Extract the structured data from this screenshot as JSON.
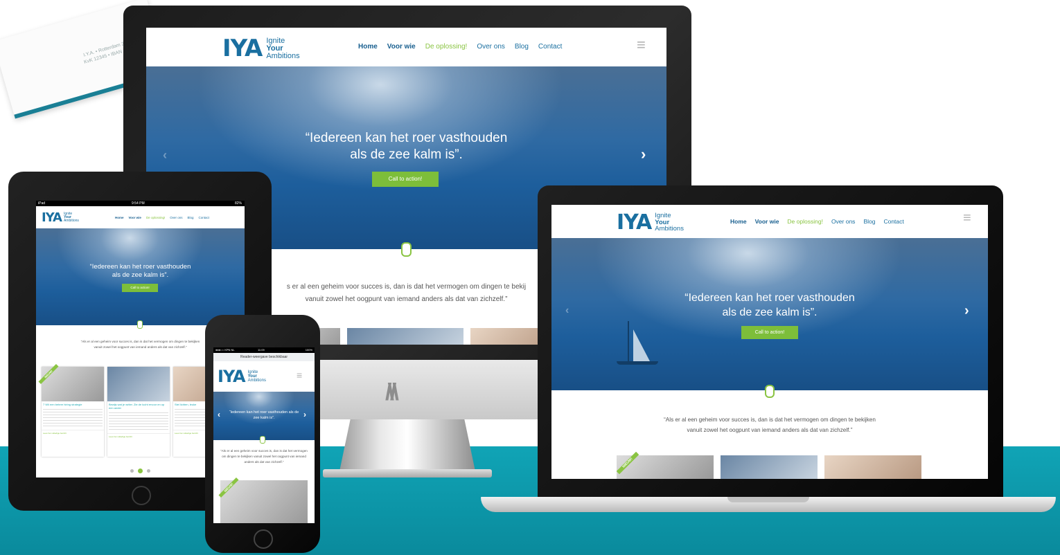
{
  "brand": {
    "mark": "IYA",
    "line1": "Ignite",
    "line2": "Your",
    "line3": "Ambitions"
  },
  "nav": {
    "items": [
      "Home",
      "Voor wie",
      "De oplossing!",
      "Over ons",
      "Blog",
      "Contact"
    ],
    "active": "De oplossing!"
  },
  "hero": {
    "quote_line1": "“Iedereen kan het roer vasthouden",
    "quote_line2": "als de zee kalm is”.",
    "phone_quote": "“Iedereen kan het roer vasthouden als de zee kalm is”.",
    "cta": "Call to action!"
  },
  "intro": {
    "line1": "“Als er al een geheim voor succes is, dan is dat het vermogen om dingen te bekijken",
    "line2": "vanuit zowel het oogpunt van iemand anders als dat van zichzelf.”",
    "imac_line1": "s er al een geheim voor succes is, dan is dat het vermogen om dingen te bekij",
    "imac_line2": "vanuit zowel het oogpunt van iemand anders als dat van zichzelf.”"
  },
  "badge": "NIEUW!",
  "iphone": {
    "status_left": "●●●○○ KPN NL",
    "status_time": "11:09",
    "status_right": "100%",
    "urlbar": "Reader-weergave beschikbaar"
  },
  "ipad": {
    "status_left": "iPad",
    "status_time": "9:54 PM",
    "status_right": "82%",
    "cards": [
      {
        "title": "7 Wil een betere hiring strategie",
        "more": "Lees het volledige bericht"
      },
      {
        "title": "Bewijs wat je writer. Zie de lucht ervoor en op een ander",
        "more": "Lees het volledige bericht"
      },
      {
        "title": "Stel lichten, leuke",
        "more": "Lees het volledige bericht"
      }
    ]
  },
  "card_text": {
    "line1": "I.Y.A. • Rotterdam 21 • 123",
    "line2": "KvK 12345 • IBAN NL00 RABO 0000"
  },
  "colors": {
    "teal_band": "#10a4b6",
    "brand_blue": "#1a6fa0",
    "accent_green": "#8ac442"
  }
}
